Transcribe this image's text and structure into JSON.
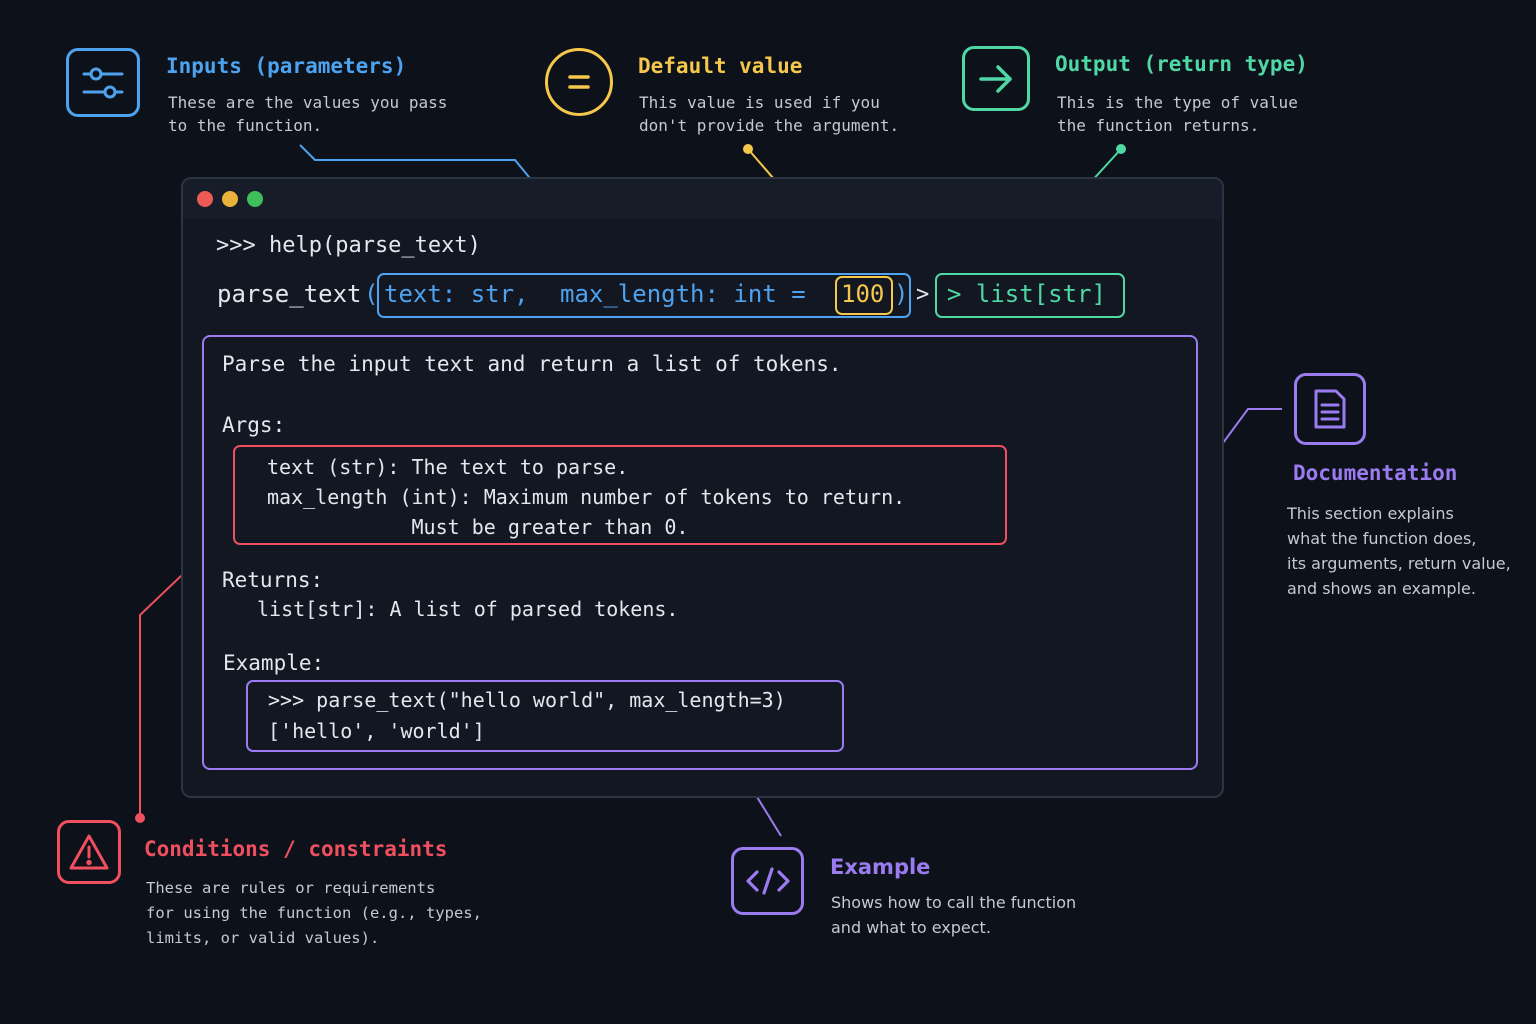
{
  "colors": {
    "background": "#0d1119",
    "inputs": "#4ea3f0",
    "default": "#f5c84c",
    "output": "#4fd8a4",
    "documentation": "#9b7cf0",
    "conditions": "#ef4f5f",
    "example": "#9b7cf0"
  },
  "icons": {
    "inputs": "sliders-icon",
    "default": "equals-icon",
    "output": "arrow-right-icon",
    "documentation": "document-icon",
    "conditions": "warning-icon",
    "example": "code-brackets-icon"
  },
  "callouts": {
    "inputs": {
      "title": "Inputs (parameters)",
      "desc": "These are the values you pass\nto the function."
    },
    "default": {
      "title": "Default value",
      "desc": "This value is used if you\ndon't provide the argument."
    },
    "output": {
      "title": "Output (return type)",
      "desc": "This is the type of value\nthe function returns."
    },
    "documentation": {
      "title": "Documentation",
      "desc": "This section explains\nwhat the function does,\nits arguments, return value,\nand shows an example."
    },
    "conditions": {
      "title": "Conditions / constraints",
      "desc": "These are rules or requirements\nfor using the function (e.g., types,\nlimits, or valid values)."
    },
    "example": {
      "title": "Example",
      "desc": "Shows how to call the function\nand what to expect."
    }
  },
  "terminal": {
    "prompt_line": ">>> help(parse_text)",
    "signature": {
      "name": "parse_text",
      "open_paren": "(",
      "param1": "text: str,",
      "param2": "max_length: int =",
      "default_value": "100",
      "close_paren": ")",
      "arrow": ">",
      "return_type": "> list[str]"
    },
    "doc": {
      "summary": "Parse the input text and return a list of tokens.",
      "args_header": "Args:",
      "args": [
        "text (str): The text to parse.",
        "max_length (int): Maximum number of tokens to return.",
        "            Must be greater than 0."
      ],
      "returns_header": "Returns:",
      "returns_line": "list[str]: A list of parsed tokens.",
      "example_header": "Example:",
      "example_lines": [
        ">>> parse_text(\"hello world\", max_length=3)",
        "['hello', 'world']"
      ]
    }
  }
}
